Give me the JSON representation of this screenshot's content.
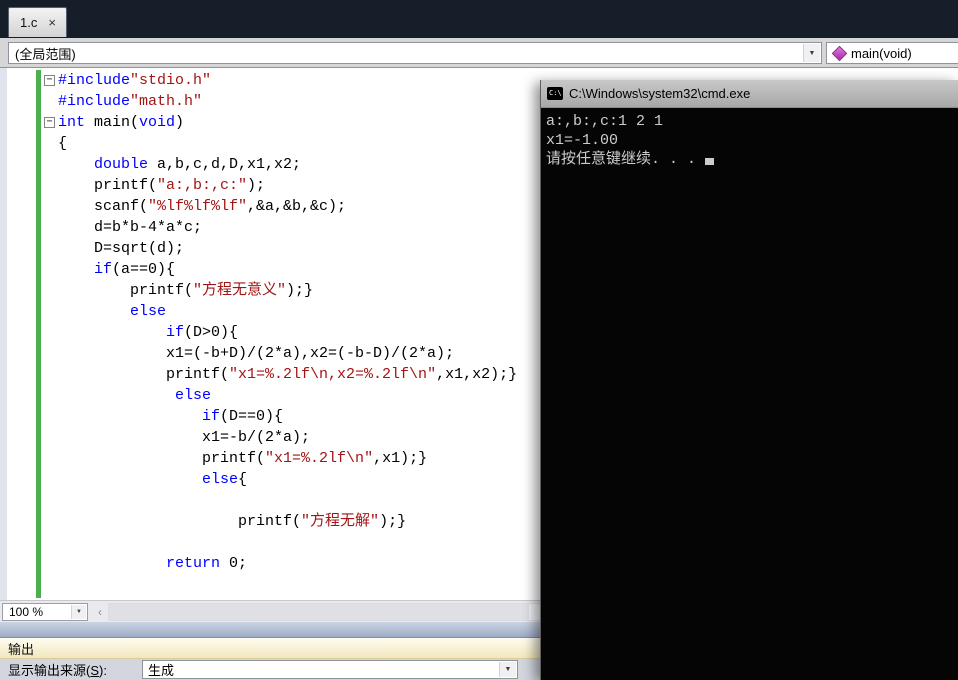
{
  "icons": {
    "chevron_down": "▼",
    "scroll_left": "‹",
    "fold_collapse": "−",
    "cmd_icon_text": "C:\\",
    "close": "×"
  },
  "tab_bar": {
    "tabs": [
      {
        "label": "1.c",
        "close": "×",
        "active": true
      }
    ]
  },
  "navbar": {
    "scope_combo": {
      "value": "(全局范围)"
    },
    "member_combo": {
      "value": "main(void)"
    }
  },
  "editor": {
    "token_colors": {
      "kw": "#0000ff",
      "str": "#a31515",
      "plain": "#000000"
    },
    "change_bar_color": "#4cae4c",
    "lines": [
      {
        "fold": true,
        "segs": [
          [
            "kw",
            "#include"
          ],
          [
            "str",
            "\"stdio.h\""
          ]
        ]
      },
      {
        "segs": [
          [
            "kw",
            "#include"
          ],
          [
            "str",
            "\"math.h\""
          ]
        ]
      },
      {
        "fold": true,
        "segs": [
          [
            "kw",
            "int"
          ],
          [
            "plain",
            " main("
          ],
          [
            "kw",
            "void"
          ],
          [
            "plain",
            ")"
          ]
        ]
      },
      {
        "segs": [
          [
            "plain",
            "{"
          ]
        ]
      },
      {
        "segs": [
          [
            "plain",
            "    "
          ],
          [
            "kw",
            "double"
          ],
          [
            "plain",
            " a,b,c,d,D,x1,x2;"
          ]
        ]
      },
      {
        "segs": [
          [
            "plain",
            "    printf("
          ],
          [
            "str",
            "\"a:,b:,c:\""
          ],
          [
            "plain",
            ");"
          ]
        ]
      },
      {
        "segs": [
          [
            "plain",
            "    scanf("
          ],
          [
            "str",
            "\"%lf%lf%lf\""
          ],
          [
            "plain",
            ",&a,&b,&c);"
          ]
        ]
      },
      {
        "segs": [
          [
            "plain",
            "    d=b*b-4*a*c;"
          ]
        ]
      },
      {
        "segs": [
          [
            "plain",
            "    D=sqrt(d);"
          ]
        ]
      },
      {
        "segs": [
          [
            "plain",
            "    "
          ],
          [
            "kw",
            "if"
          ],
          [
            "plain",
            "(a==0){"
          ]
        ]
      },
      {
        "segs": [
          [
            "plain",
            "        printf("
          ],
          [
            "str",
            "\"方程无意义\""
          ],
          [
            "plain",
            ");}"
          ]
        ]
      },
      {
        "segs": [
          [
            "plain",
            "        "
          ],
          [
            "kw",
            "else"
          ]
        ]
      },
      {
        "segs": [
          [
            "plain",
            "            "
          ],
          [
            "kw",
            "if"
          ],
          [
            "plain",
            "(D>0){"
          ]
        ]
      },
      {
        "segs": [
          [
            "plain",
            "            x1=(-b+D)/(2*a),x2=(-b-D)/(2*a);"
          ]
        ]
      },
      {
        "segs": [
          [
            "plain",
            "            printf("
          ],
          [
            "str",
            "\"x1=%.2lf\\n,x2=%.2lf\\n\""
          ],
          [
            "plain",
            ",x1,x2);}"
          ]
        ]
      },
      {
        "segs": [
          [
            "plain",
            "             "
          ],
          [
            "kw",
            "else"
          ]
        ]
      },
      {
        "segs": [
          [
            "plain",
            "                "
          ],
          [
            "kw",
            "if"
          ],
          [
            "plain",
            "(D==0){"
          ]
        ]
      },
      {
        "segs": [
          [
            "plain",
            "                x1=-b/(2*a);"
          ]
        ]
      },
      {
        "segs": [
          [
            "plain",
            "                printf("
          ],
          [
            "str",
            "\"x1=%.2lf\\n\""
          ],
          [
            "plain",
            ",x1);}"
          ]
        ]
      },
      {
        "segs": [
          [
            "plain",
            "                "
          ],
          [
            "kw",
            "else"
          ],
          [
            "plain",
            "{"
          ]
        ]
      },
      {
        "segs": []
      },
      {
        "segs": [
          [
            "plain",
            "                    printf("
          ],
          [
            "str",
            "\"方程无解\""
          ],
          [
            "plain",
            ");}"
          ]
        ]
      },
      {
        "segs": []
      },
      {
        "segs": [
          [
            "plain",
            "            "
          ],
          [
            "kw",
            "return"
          ],
          [
            "plain",
            " 0;"
          ]
        ]
      }
    ]
  },
  "status": {
    "zoom": "100 %"
  },
  "output_panel": {
    "header": "输出",
    "source_label_prefix": "显示输出来源(",
    "source_access_key": "S",
    "source_label_suffix": "):",
    "source_value": "生成"
  },
  "cmd_window": {
    "titlebar": {
      "title": "C:\\Windows\\system32\\cmd.exe"
    },
    "lines": [
      "a:,b:,c:1 2 1",
      "x1=-1.00",
      "请按任意键继续. . ."
    ],
    "cursor": true
  }
}
